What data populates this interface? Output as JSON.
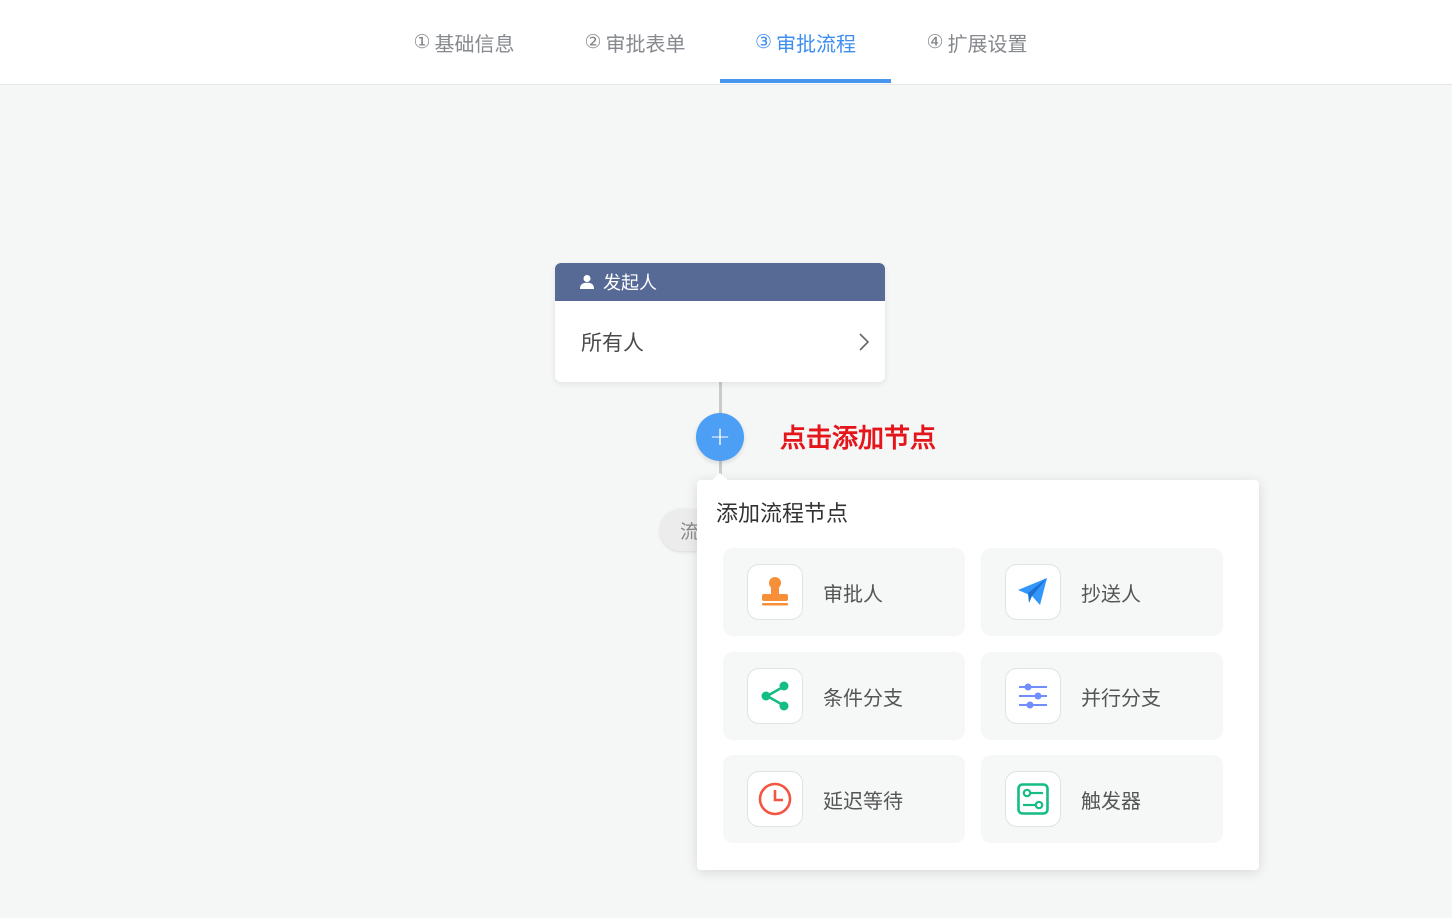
{
  "tabs": [
    {
      "num": "①",
      "label": "基础信息",
      "active": false
    },
    {
      "num": "②",
      "label": "审批表单",
      "active": false
    },
    {
      "num": "③",
      "label": "审批流程",
      "active": true
    },
    {
      "num": "④",
      "label": "扩展设置",
      "active": false
    }
  ],
  "start_node": {
    "title": "发起人",
    "value": "所有人",
    "icon": "user-icon"
  },
  "add_button": {
    "symbol": "+"
  },
  "hint": "点击添加节点",
  "hidden_pill": "流",
  "popover": {
    "title": "添加流程节点",
    "items": [
      {
        "label": "审批人",
        "icon": "approver-stamp-icon",
        "color": "#f78f39"
      },
      {
        "label": "抄送人",
        "icon": "paper-plane-icon",
        "color": "#3296fa"
      },
      {
        "label": "条件分支",
        "icon": "share-branch-icon",
        "color": "#15bc83"
      },
      {
        "label": "并行分支",
        "icon": "sliders-icon",
        "color": "#718dff"
      },
      {
        "label": "延迟等待",
        "icon": "clock-icon",
        "color": "#f25643"
      },
      {
        "label": "触发器",
        "icon": "trigger-icon",
        "color": "#15bc83"
      }
    ]
  },
  "colors": {
    "accent": "#3d8ef0",
    "start_header": "#576a95",
    "hint": "#e5161b"
  }
}
